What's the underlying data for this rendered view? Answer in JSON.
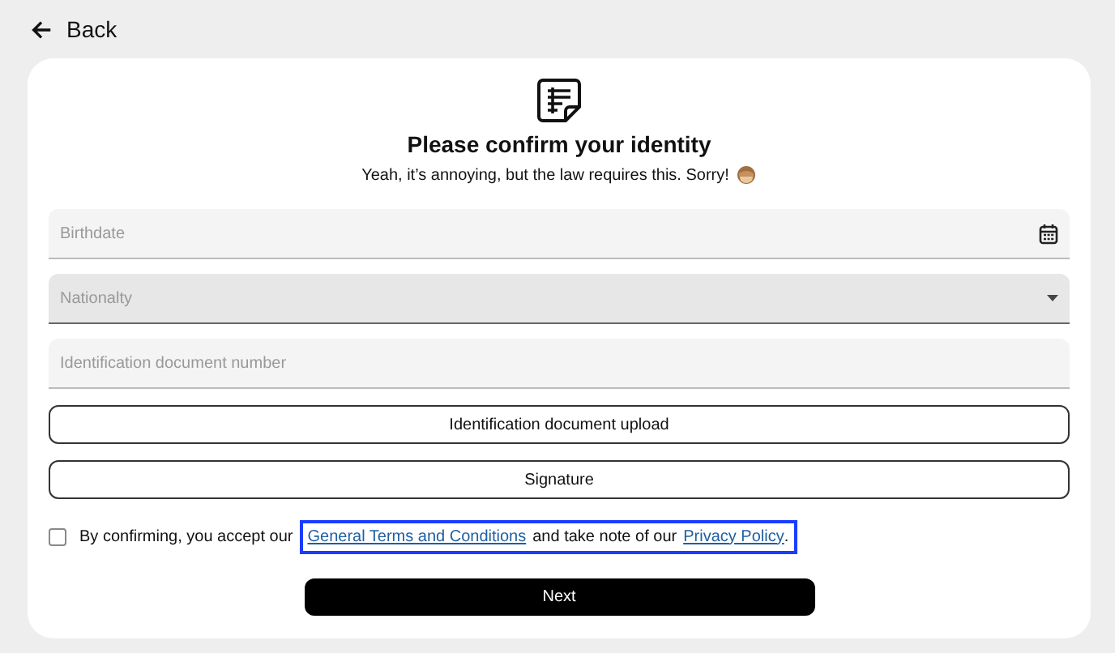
{
  "back": {
    "label": "Back"
  },
  "header": {
    "title": "Please confirm your identity",
    "subtitle": "Yeah, it’s annoying, but the law requires this. Sorry!"
  },
  "fields": [
    {
      "kind": "date",
      "placeholder": "Birthdate",
      "disabled": false
    },
    {
      "kind": "select",
      "placeholder": "Nationalty",
      "disabled": true
    },
    {
      "kind": "text",
      "placeholder": "Identification document number",
      "disabled": false
    }
  ],
  "buttons": [
    "Identification document upload",
    "Signature"
  ],
  "consent": {
    "checked": false,
    "highlighted": true,
    "text_before": "By confirming, you accept our",
    "terms_link": "General Terms and Conditions",
    "text_middle": "and take note of our",
    "privacy_link": "Privacy Policy",
    "text_after": "."
  },
  "next": {
    "label": "Next"
  }
}
